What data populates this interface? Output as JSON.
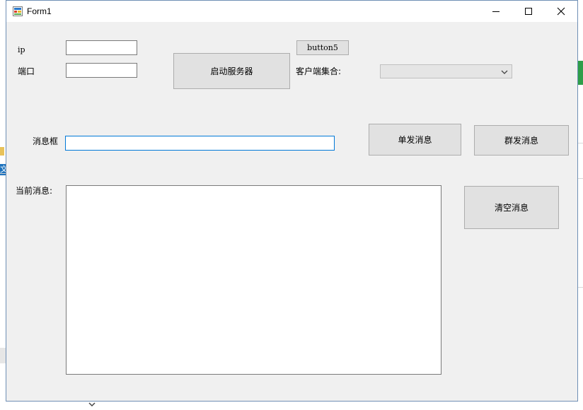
{
  "window": {
    "title": "Form1",
    "controls": {
      "minimize": "minimize-icon",
      "maximize": "maximize-icon",
      "close": "close-icon"
    }
  },
  "form": {
    "ip_label": "ip",
    "ip_value": "",
    "port_label": "端口",
    "port_value": "",
    "start_server_button": "启动服务器",
    "button5": "button5",
    "clients_label": "客户端集合:",
    "clients_selected": "",
    "message_label": "消息框",
    "message_value": "",
    "send_single_button": "单发消息",
    "send_group_button": "群发消息",
    "current_messages_label": "当前消息:",
    "current_messages_value": "",
    "clear_button": "清空消息"
  },
  "background": {
    "fragment_text": "文"
  },
  "colors": {
    "accent": "#0078d7",
    "window_bg": "#f0f0f0",
    "button_bg": "#e1e1e1"
  }
}
